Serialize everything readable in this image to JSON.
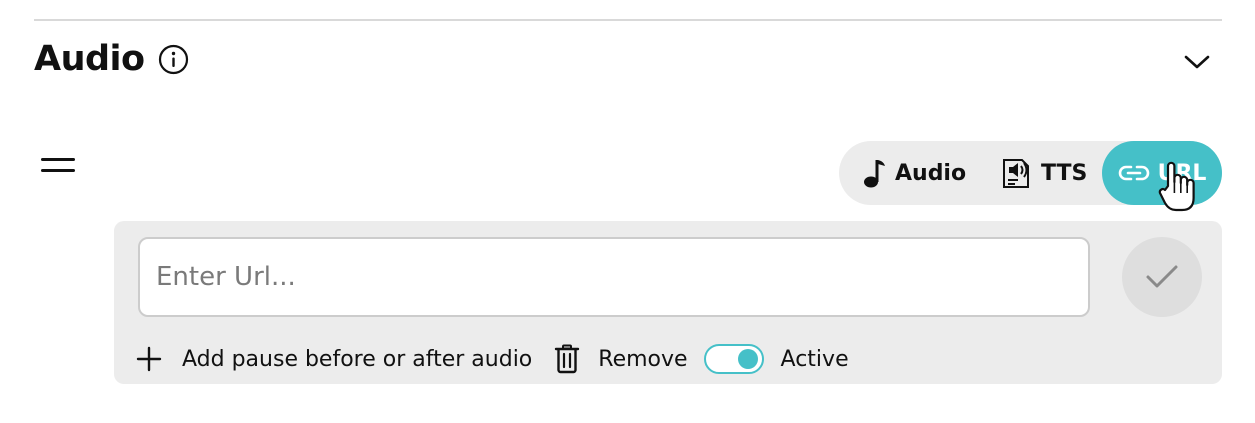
{
  "section": {
    "title": "Audio",
    "info_icon": "info-circle-icon",
    "collapse_icon": "chevron-down-icon"
  },
  "source_tabs": {
    "items": [
      {
        "label": "Audio",
        "icon": "music-note-icon",
        "active": false
      },
      {
        "label": "TTS",
        "icon": "speaker-document-icon",
        "active": false
      },
      {
        "label": "URL",
        "icon": "link-icon",
        "active": true
      }
    ]
  },
  "url_input": {
    "value": "",
    "placeholder": "Enter Url..."
  },
  "actions": {
    "add_pause_label": "Add pause before or after audio",
    "remove_label": "Remove",
    "active_label": "Active",
    "active_on": true
  },
  "colors": {
    "accent": "#45c0c8",
    "panel_bg": "#ececec",
    "divider": "#d9d9d9"
  }
}
